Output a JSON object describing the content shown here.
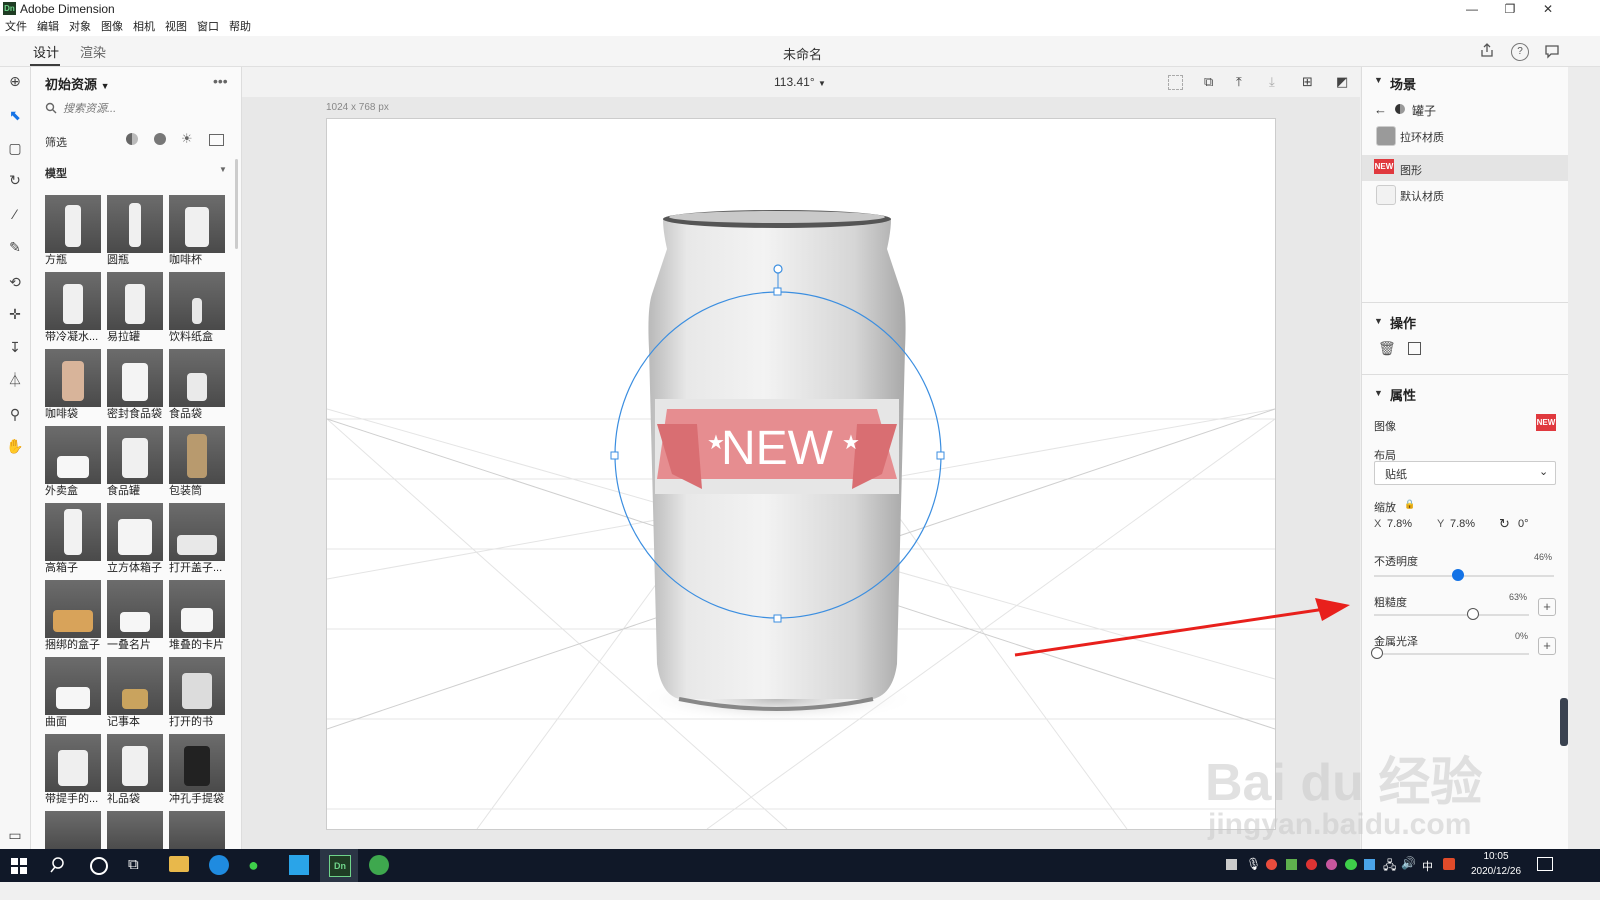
{
  "app": {
    "title": "Adobe Dimension",
    "logo": "Dn",
    "doc_title": "未命名"
  },
  "menu": [
    "文件",
    "编辑",
    "对象",
    "图像",
    "相机",
    "视图",
    "窗口",
    "帮助"
  ],
  "mode_tabs": [
    "设计",
    "渲染"
  ],
  "assets": {
    "title": "初始资源",
    "search_placeholder": "搜索资源...",
    "filter_label": "筛选",
    "category": "模型",
    "items": [
      "方瓶",
      "圆瓶",
      "咖啡杯",
      "带冷凝水...",
      "易拉罐",
      "饮料纸盒",
      "咖啡袋",
      "密封食品袋",
      "食品袋",
      "外卖盒",
      "食品罐",
      "包装筒",
      "高箱子",
      "立方体箱子",
      "打开盖子...",
      "捆绑的盒子",
      "一叠名片",
      "堆叠的卡片",
      "曲面",
      "记事本",
      "打开的书",
      "带提手的...",
      "礼品袋",
      "冲孔手提袋"
    ]
  },
  "viewport": {
    "zoom": "113.41°",
    "canvas_size": "1024 x 768 px",
    "label_text": "NEW"
  },
  "scene": {
    "title": "场景",
    "object": "罐子",
    "materials": [
      {
        "label": "拉环材质",
        "color": "#9a9a9a"
      },
      {
        "label": "图形",
        "color": "#e0393e"
      },
      {
        "label": "默认材质",
        "color": "#f2f2f2"
      }
    ]
  },
  "actions": {
    "title": "操作"
  },
  "properties": {
    "title": "属性",
    "image_label": "图像",
    "image_thumb_text": "NEW",
    "layout_label": "布局",
    "layout_value": "贴纸",
    "scale_label": "缩放",
    "scale_x_label": "X",
    "scale_x": "7.8%",
    "scale_y_label": "Y",
    "scale_y": "7.8%",
    "rotation": "0°",
    "opacity_label": "不透明度",
    "opacity_value": "46%",
    "opacity_level": 0.46,
    "roughness_label": "粗糙度",
    "roughness_value": "63%",
    "roughness_level": 0.63,
    "metallic_label": "金属光泽",
    "metallic_value": "0%",
    "metallic_level": 0
  },
  "taskbar": {
    "time": "10:05",
    "date": "2020/12/26",
    "ime": "中"
  },
  "watermark": {
    "brand": "Bai du 经验",
    "url": "jingyan.baidu.com"
  },
  "colors": {
    "accent": "#1473e6",
    "arrow": "#e8201c",
    "taskbar": "#101828"
  }
}
